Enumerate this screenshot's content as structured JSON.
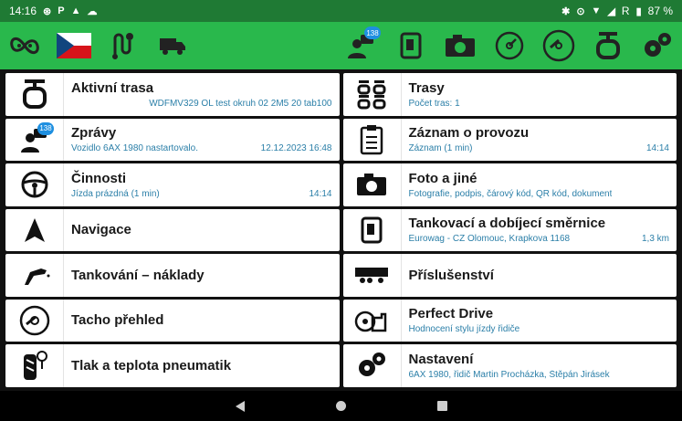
{
  "status_bar": {
    "time": "14:16",
    "left_icons": [
      "link-icon",
      "parking-icon",
      "cloud-upload-icon",
      "cloud-icon"
    ],
    "right_icons": [
      "bluetooth-icon",
      "location-icon",
      "wifi-icon",
      "signal-icon"
    ],
    "network_label": "R",
    "battery": "87 %"
  },
  "toolbar": {
    "left_icons": [
      "pretzel-icon",
      "czech-flag-icon",
      "route-pins-icon",
      "truck-icon"
    ],
    "right_icons": [
      "messages-icon",
      "fuel-pump-icon",
      "camera-icon",
      "tachograph-icon",
      "speedometer-icon",
      "active-route-icon",
      "settings-icon"
    ],
    "messages_badge": "138"
  },
  "left_column": [
    {
      "title": "Aktivní trasa",
      "sub_left": "",
      "sub_right": "WDFMV329 OL test okruh 02 2M5  20 tab100",
      "icon": "active-route-icon"
    },
    {
      "title": "Zprávy",
      "sub_left": "Vozidlo 6AX 1980 nastartovalo.",
      "sub_right": "12.12.2023 16:48",
      "icon": "messages-icon",
      "badge": "138"
    },
    {
      "title": "Činnosti",
      "sub_left": "Jízda prázdná (1 min)",
      "sub_right": "14:14",
      "icon": "steering-wheel-icon"
    },
    {
      "title": "Navigace",
      "sub_left": "",
      "sub_right": "",
      "icon": "navigation-arrow-icon"
    },
    {
      "title": "Tankování – náklady",
      "sub_left": "",
      "sub_right": "",
      "icon": "fuel-nozzle-icon"
    },
    {
      "title": "Tacho přehled",
      "sub_left": "",
      "sub_right": "",
      "icon": "speedometer-icon"
    },
    {
      "title": "Tlak a teplota pneumatik",
      "sub_left": "",
      "sub_right": "",
      "icon": "tire-pressure-icon"
    }
  ],
  "right_column": [
    {
      "title": "Trasy",
      "sub_left": "Počet tras: 1",
      "sub_right": "",
      "icon": "routes-icon"
    },
    {
      "title": "Záznam o provozu",
      "sub_left": "Záznam (1 min)",
      "sub_right": "14:14",
      "icon": "clipboard-icon"
    },
    {
      "title": "Foto a jiné",
      "sub_left": "Fotografie, podpis, čárový kód, QR kód, dokument",
      "sub_right": "",
      "icon": "camera-icon"
    },
    {
      "title": "Tankovací a dobíjecí směrnice",
      "sub_left": "Eurowag - CZ Olomouc, Krapkova 1168",
      "sub_right": "1,3 km",
      "icon": "fuel-pump-icon"
    },
    {
      "title": "Příslušenství",
      "sub_left": "",
      "sub_right": "",
      "icon": "trailer-icon"
    },
    {
      "title": "Perfect Drive",
      "sub_left": "Hodnocení stylu jízdy řidiče",
      "sub_right": "",
      "icon": "perfect-drive-icon"
    },
    {
      "title": "Nastavení",
      "sub_left": "6AX 1980, řidič Martin Procházka, Štěpán Jirásek",
      "sub_right": "",
      "icon": "settings-icon"
    }
  ],
  "colors": {
    "toolbar_green": "#29b84c",
    "status_green": "#1f7a34",
    "subtitle_blue": "#2b7fa8",
    "badge_blue": "#1e8fe0"
  }
}
